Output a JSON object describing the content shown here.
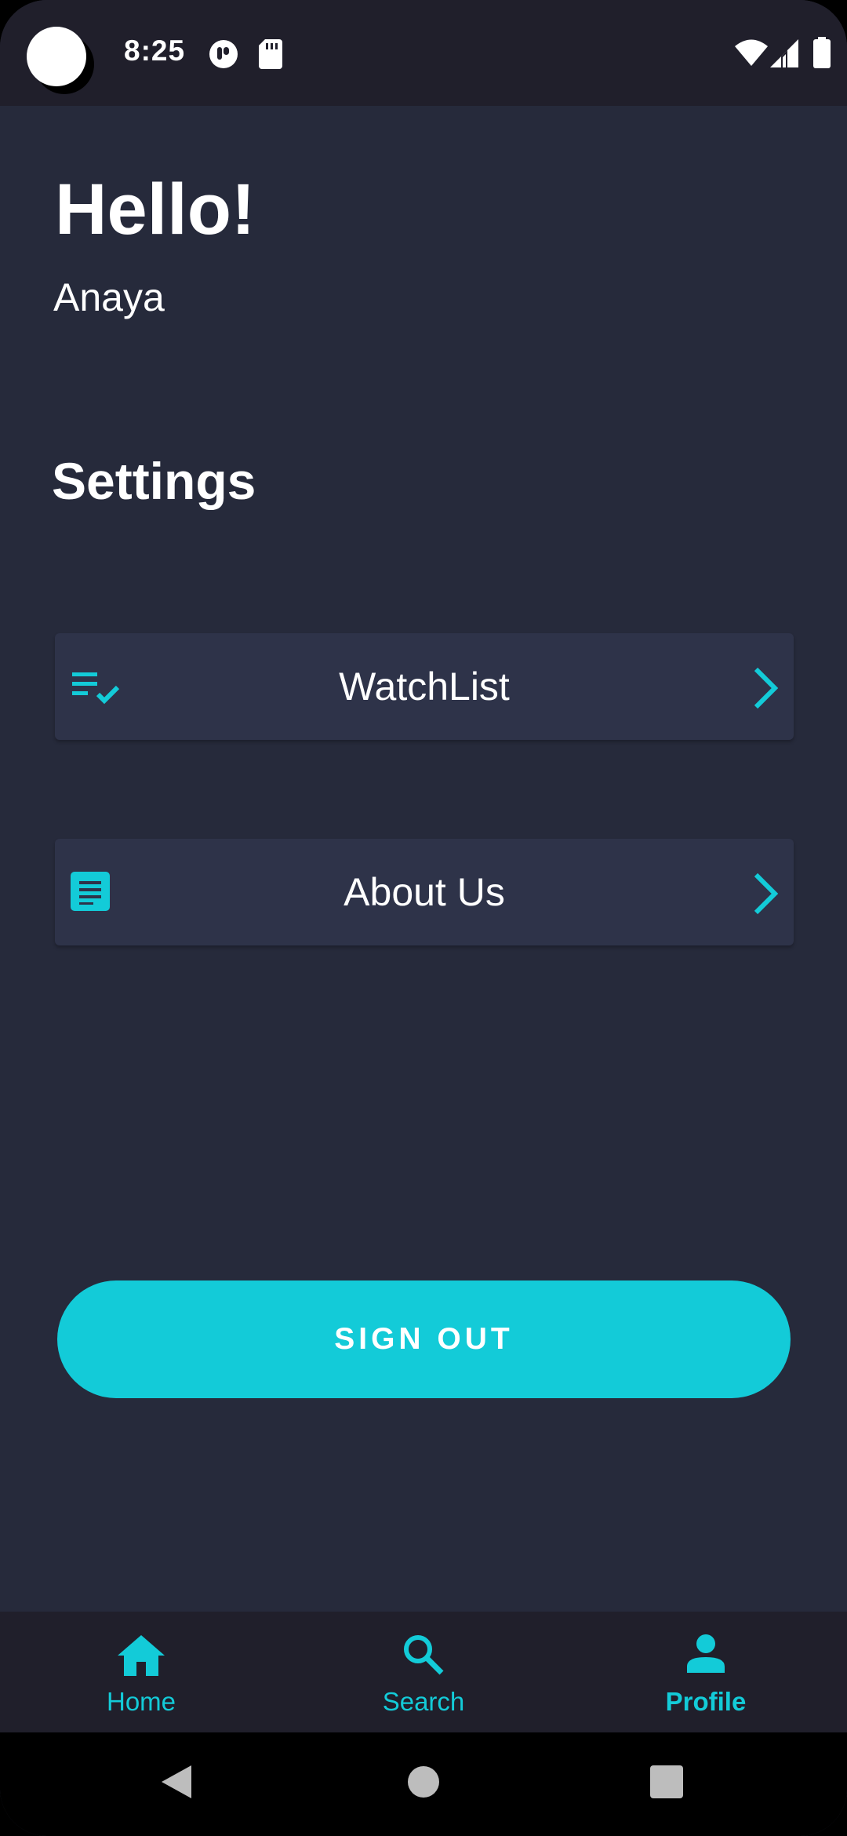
{
  "status_bar": {
    "time": "8:25",
    "icons": [
      "camera-dot",
      "podcast-icon",
      "sd-card-icon",
      "wifi-icon",
      "signal-icon",
      "battery-icon"
    ]
  },
  "header": {
    "greeting": "Hello!",
    "username": "Anaya"
  },
  "settings": {
    "title": "Settings",
    "items": [
      {
        "label": "WatchList",
        "icon": "playlist-check-icon"
      },
      {
        "label": "About Us",
        "icon": "article-icon"
      }
    ]
  },
  "sign_out_label": "SIGN OUT",
  "bottom_nav": {
    "items": [
      {
        "label": "Home",
        "icon": "home-icon",
        "active": false
      },
      {
        "label": "Search",
        "icon": "search-icon",
        "active": false
      },
      {
        "label": "Profile",
        "icon": "person-icon",
        "active": true
      }
    ]
  },
  "colors": {
    "accent": "#13cbd8",
    "background": "#262a3b",
    "card": "#2e3349",
    "bar": "#201f2b"
  }
}
